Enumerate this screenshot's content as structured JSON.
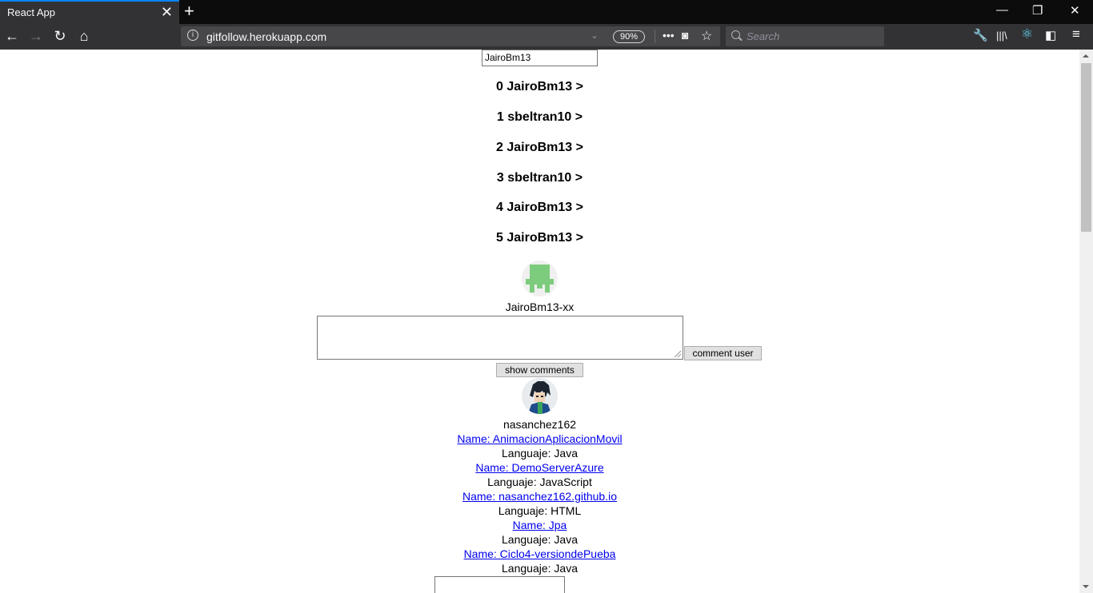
{
  "tab": {
    "title": "React App",
    "close": "✕",
    "new_tab": "+"
  },
  "window_controls": {
    "minimize": "—",
    "restore": "❐",
    "close": "✕"
  },
  "nav": {
    "back": "←",
    "forward": "→",
    "reload": "↻",
    "home": "⌂"
  },
  "url": {
    "text": "gitfollow.herokuapp.com",
    "zoom": "90%",
    "info": "i",
    "dropdown": "⌄",
    "more": "•••",
    "pocket": "◙",
    "bookmark": "☆"
  },
  "search": {
    "placeholder": "Search"
  },
  "toolbar": {
    "wrench": "🔧",
    "library": "|||\\",
    "react": "⚛",
    "sidebar": "◧",
    "menu": "≡"
  },
  "page": {
    "username_input": "JairoBm13",
    "follow_list": [
      "0 JairoBm13 >",
      "1 sbeltran10 >",
      "2 JairoBm13 >",
      "3 sbeltran10 >",
      "4 JairoBm13 >",
      "5 JairoBm13 >"
    ],
    "profile_name": "JairoBm13-xx",
    "comment_button": "comment user",
    "show_comments_button": "show comments",
    "follower_name": "nasanchez162",
    "repos": [
      {
        "name": "Name: AnimacionAplicacionMovil",
        "lang": "Languaje: Java"
      },
      {
        "name": "Name: DemoServerAzure",
        "lang": "Languaje: JavaScript"
      },
      {
        "name": "Name: nasanchez162.github.io",
        "lang": "Languaje: HTML"
      },
      {
        "name": "Name: Jpa",
        "lang": "Languaje: Java"
      },
      {
        "name": "Name: Ciclo4-versiondePueba",
        "lang": "Languaje: Java"
      }
    ]
  },
  "colors": {
    "link": "#0000ee",
    "chrome_dark": "#0c0c0d",
    "toolbar": "#323234",
    "accent": "#0a84ff",
    "identicon": "#7dcc7d"
  }
}
